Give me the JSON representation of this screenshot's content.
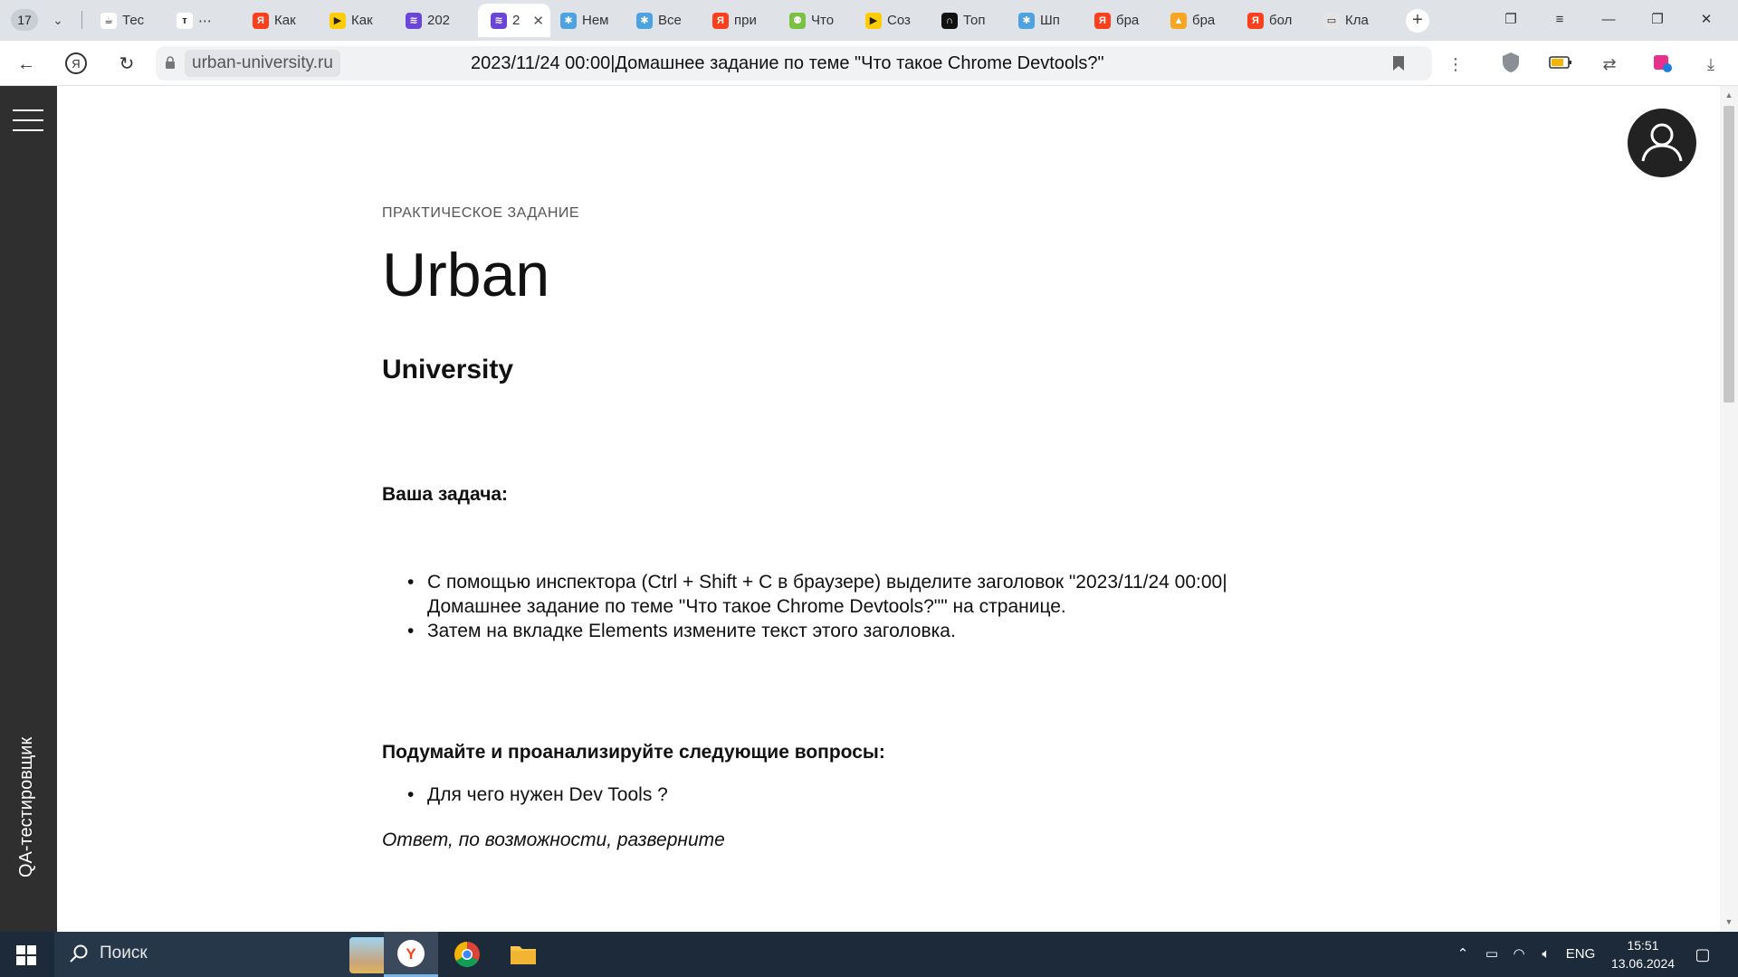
{
  "browser": {
    "tab_count": "17",
    "tabs": [
      {
        "label": "Тес",
        "fav_color": "#ffffff",
        "fav_text": "☕"
      },
      {
        "label": "⋯",
        "fav_color": "#ffffff",
        "fav_text": "т"
      },
      {
        "label": "Как",
        "fav_color": "#fc3f1d",
        "fav_text": "Я"
      },
      {
        "label": "Как",
        "fav_color": "#ffcc00",
        "fav_text": "▶"
      },
      {
        "label": "202",
        "fav_color": "#6a45d8",
        "fav_text": "≋"
      },
      {
        "label": "2",
        "fav_color": "#6a45d8",
        "fav_text": "≋"
      },
      {
        "label": "Нем",
        "fav_color": "#4da3e0",
        "fav_text": "✱"
      },
      {
        "label": "Все",
        "fav_color": "#4da3e0",
        "fav_text": "✱"
      },
      {
        "label": "при",
        "fav_color": "#fc3f1d",
        "fav_text": "Я"
      },
      {
        "label": "Что",
        "fav_color": "#7ac043",
        "fav_text": "⚉"
      },
      {
        "label": "Соз",
        "fav_color": "#ffcc00",
        "fav_text": "▶"
      },
      {
        "label": "Топ",
        "fav_color": "#111111",
        "fav_text": "∩"
      },
      {
        "label": "Шп",
        "fav_color": "#4da3e0",
        "fav_text": "✱"
      },
      {
        "label": "бра",
        "fav_color": "#fc3f1d",
        "fav_text": "Я"
      },
      {
        "label": "бра",
        "fav_color": "#f5a623",
        "fav_text": "▲"
      },
      {
        "label": "бол",
        "fav_color": "#fc3f1d",
        "fav_text": "Я"
      },
      {
        "label": "Кла",
        "fav_color": "#e5e5e5",
        "fav_text": "▭"
      }
    ],
    "url_domain": "urban-university.ru",
    "page_title": "2023/11/24 00:00|Домашнее задание по теме \"Что такое Chrome Devtools?\""
  },
  "sidebar": {
    "course_label": "QA-тестировщик"
  },
  "page": {
    "kicker": "ПРАКТИЧЕСКОЕ ЗАДАНИЕ",
    "title": "Urban",
    "subtitle": "University",
    "task_heading": "Ваша задача:",
    "task_items": [
      "С помощью инспектора (Ctrl + Shift + C в браузере) выделите заголовок \"2023/11/24 00:00| Домашнее задание по теме \"Что такое Chrome Devtools?\"\" на странице.",
      "Затем на вкладке Elements измените текст этого заголовка."
    ],
    "questions_heading": "Подумайте и проанализируйте следующие вопросы:",
    "question_items": [
      "Для чего нужен Dev Tools ?"
    ],
    "answer_note": "Ответ, по возможности, разверните"
  },
  "taskbar": {
    "search_placeholder": "Поиск",
    "language": "ENG",
    "time": "15:51",
    "date": "13.06.2024"
  },
  "colors": {
    "sidebar_bg": "#2f2f2f",
    "taskbar_bg": "#1c2a3a",
    "tabbar_bg": "#dfe3e8"
  }
}
